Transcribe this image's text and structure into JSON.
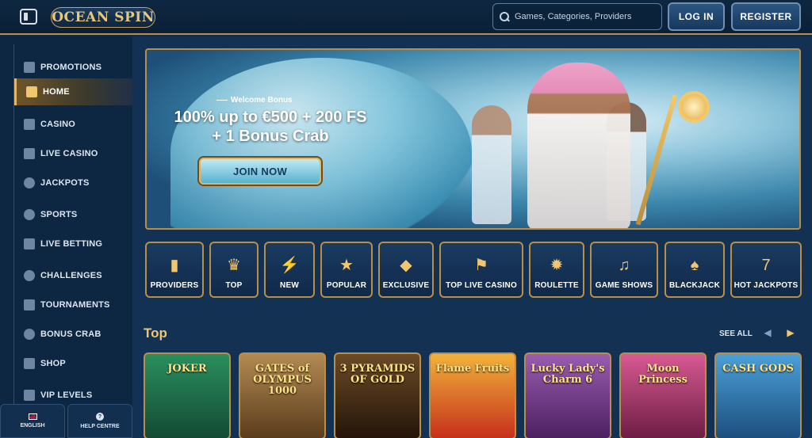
{
  "header": {
    "logo_text": "OCEAN SPIN",
    "search_placeholder": "Games, Categories, Providers",
    "login_label": "LOG IN",
    "register_label": "REGISTER"
  },
  "sidebar": {
    "items": [
      {
        "label": "PROMOTIONS",
        "icon": "gift-icon"
      },
      {
        "label": "HOME",
        "icon": "home-icon",
        "active": true
      },
      {
        "label": "CASINO",
        "icon": "cards-icon"
      },
      {
        "label": "LIVE CASINO",
        "icon": "live-casino-icon"
      },
      {
        "label": "JACKPOTS",
        "icon": "clover-icon"
      },
      {
        "label": "SPORTS",
        "icon": "ball-icon"
      },
      {
        "label": "LIVE BETTING",
        "icon": "live-betting-icon"
      },
      {
        "label": "CHALLENGES",
        "icon": "trophy-icon"
      },
      {
        "label": "TOURNAMENTS",
        "icon": "cup-icon"
      },
      {
        "label": "BONUS CRAB",
        "icon": "crab-icon"
      },
      {
        "label": "SHOP",
        "icon": "basket-icon"
      },
      {
        "label": "VIP LEVELS",
        "icon": "diamond-icon"
      }
    ],
    "language_label": "ENGLISH",
    "help_label": "HELP CENTRE"
  },
  "banner": {
    "eyebrow": "Welcome Bonus",
    "headline_line1": "100% up to €500 + 200 FS",
    "headline_line2": "+ 1 Bonus Crab",
    "cta_label": "JOIN NOW"
  },
  "categories": [
    {
      "label": "PROVIDERS",
      "glyph": "▮"
    },
    {
      "label": "TOP",
      "glyph": "♛"
    },
    {
      "label": "NEW",
      "glyph": "⚡"
    },
    {
      "label": "POPULAR",
      "glyph": "★"
    },
    {
      "label": "EXCLUSIVE",
      "glyph": "◆"
    },
    {
      "label": "TOP LIVE CASINO",
      "glyph": "⚑"
    },
    {
      "label": "ROULETTE",
      "glyph": "✹"
    },
    {
      "label": "GAME SHOWS",
      "glyph": "♫"
    },
    {
      "label": "BLACKJACK",
      "glyph": "♠"
    },
    {
      "label": "HOT JACKPOTS",
      "glyph": "7"
    }
  ],
  "top_section": {
    "title": "Top",
    "see_all_label": "SEE ALL",
    "games": [
      {
        "title": "JOKER",
        "color": "#1f7a4d"
      },
      {
        "title": "GATES of OLYMPUS 1000",
        "color": "#8e6a3a"
      },
      {
        "title": "3 PYRAMIDS OF GOLD",
        "color": "#3c2a1a"
      },
      {
        "title": "Flame Fruits",
        "color": "#c83a1e"
      },
      {
        "title": "Lucky Lady's Charm 6",
        "color": "#7a3e8e"
      },
      {
        "title": "Moon Princess",
        "color": "#b3336e"
      },
      {
        "title": "CASH GODS",
        "color": "#2d6fa6"
      }
    ]
  },
  "colors": {
    "accent_gold": "#b98f48",
    "background": "#0f2a47"
  }
}
